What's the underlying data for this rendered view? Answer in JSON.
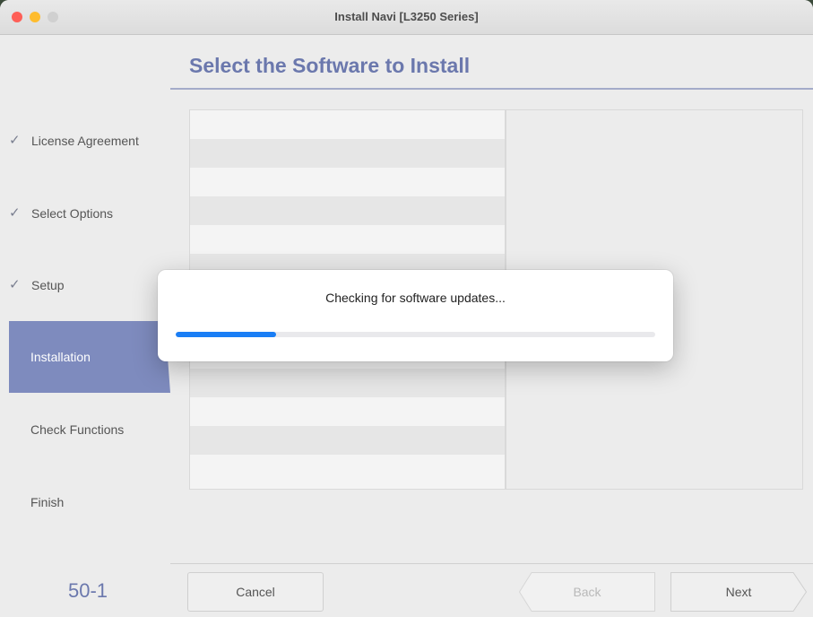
{
  "window": {
    "title": "Install Navi [L3250 Series]"
  },
  "header": {
    "title": "Select the Software to Install"
  },
  "sidebar": {
    "steps": [
      {
        "label": "License Agreement",
        "state": "done"
      },
      {
        "label": "Select Options",
        "state": "done"
      },
      {
        "label": "Setup",
        "state": "done"
      },
      {
        "label": "Installation",
        "state": "active"
      },
      {
        "label": "Check Functions",
        "state": "pending"
      },
      {
        "label": "Finish",
        "state": "pending"
      }
    ],
    "check_glyph": "✓"
  },
  "footer": {
    "page_number": "50-1",
    "cancel_label": "Cancel",
    "back_label": "Back",
    "next_label": "Next"
  },
  "modal": {
    "message": "Checking for software updates...",
    "progress": 0.21
  },
  "colors": {
    "accent": "#6b78ad",
    "active_step": "#7e8bbe",
    "progress": "#1a7ef5"
  }
}
